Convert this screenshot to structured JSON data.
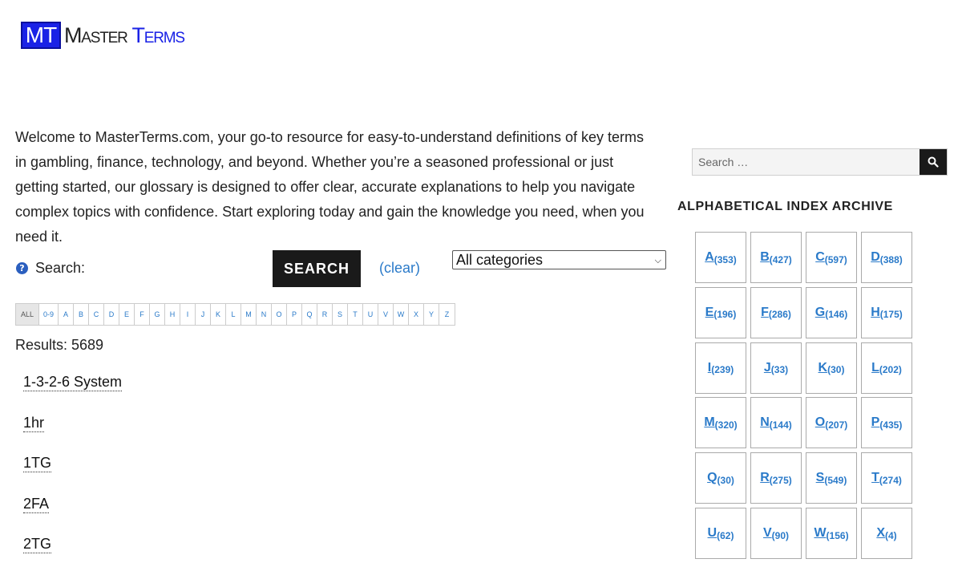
{
  "logo": {
    "badge": "MT",
    "word1": "Master",
    "word2": "Terms"
  },
  "intro": "Welcome to MasterTerms.com, your go-to resource for easy-to-understand definitions of key terms in gambling, finance, technology, and beyond. Whether you’re a seasoned professional or just getting started, our glossary is designed to offer clear, accurate explanations to help you navigate complex topics with confidence. Start exploring today and gain the knowledge you need, when you need it.",
  "search": {
    "help_icon": "question-icon",
    "label": "Search:",
    "button": "SEARCH",
    "clear": "(clear)",
    "category_selected": "All categories"
  },
  "letters": [
    "ALL",
    "0-9",
    "A",
    "B",
    "C",
    "D",
    "E",
    "F",
    "G",
    "H",
    "I",
    "J",
    "K",
    "L",
    "M",
    "N",
    "O",
    "P",
    "Q",
    "R",
    "S",
    "T",
    "U",
    "V",
    "W",
    "X",
    "Y",
    "Z"
  ],
  "results": "Results: 5689",
  "terms": [
    "1-3-2-6 System",
    "1hr",
    "1TG",
    "2FA",
    "2TG"
  ],
  "sidebar": {
    "search_placeholder": "Search …",
    "search_icon": "search-icon",
    "heading": "ALPHABETICAL INDEX ARCHIVE",
    "index": [
      {
        "letter": "A",
        "count": "(353)"
      },
      {
        "letter": "B",
        "count": "(427)"
      },
      {
        "letter": "C",
        "count": "(597)"
      },
      {
        "letter": "D",
        "count": "(388)"
      },
      {
        "letter": "E",
        "count": "(196)"
      },
      {
        "letter": "F",
        "count": "(286)"
      },
      {
        "letter": "G",
        "count": "(146)"
      },
      {
        "letter": "H",
        "count": "(175)"
      },
      {
        "letter": "I",
        "count": "(239)"
      },
      {
        "letter": "J",
        "count": "(33)"
      },
      {
        "letter": "K",
        "count": "(30)"
      },
      {
        "letter": "L",
        "count": "(202)"
      },
      {
        "letter": "M",
        "count": "(320)"
      },
      {
        "letter": "N",
        "count": "(144)"
      },
      {
        "letter": "O",
        "count": "(207)"
      },
      {
        "letter": "P",
        "count": "(435)"
      },
      {
        "letter": "Q",
        "count": "(30)"
      },
      {
        "letter": "R",
        "count": "(275)"
      },
      {
        "letter": "S",
        "count": "(549)"
      },
      {
        "letter": "T",
        "count": "(274)"
      },
      {
        "letter": "U",
        "count": "(62)"
      },
      {
        "letter": "V",
        "count": "(90)"
      },
      {
        "letter": "W",
        "count": "(156)"
      },
      {
        "letter": "X",
        "count": "(4)"
      }
    ]
  },
  "colors": {
    "brand_blue": "#1a22e6",
    "link": "#2a7ac9",
    "button_dark": "#1a1a1a"
  }
}
